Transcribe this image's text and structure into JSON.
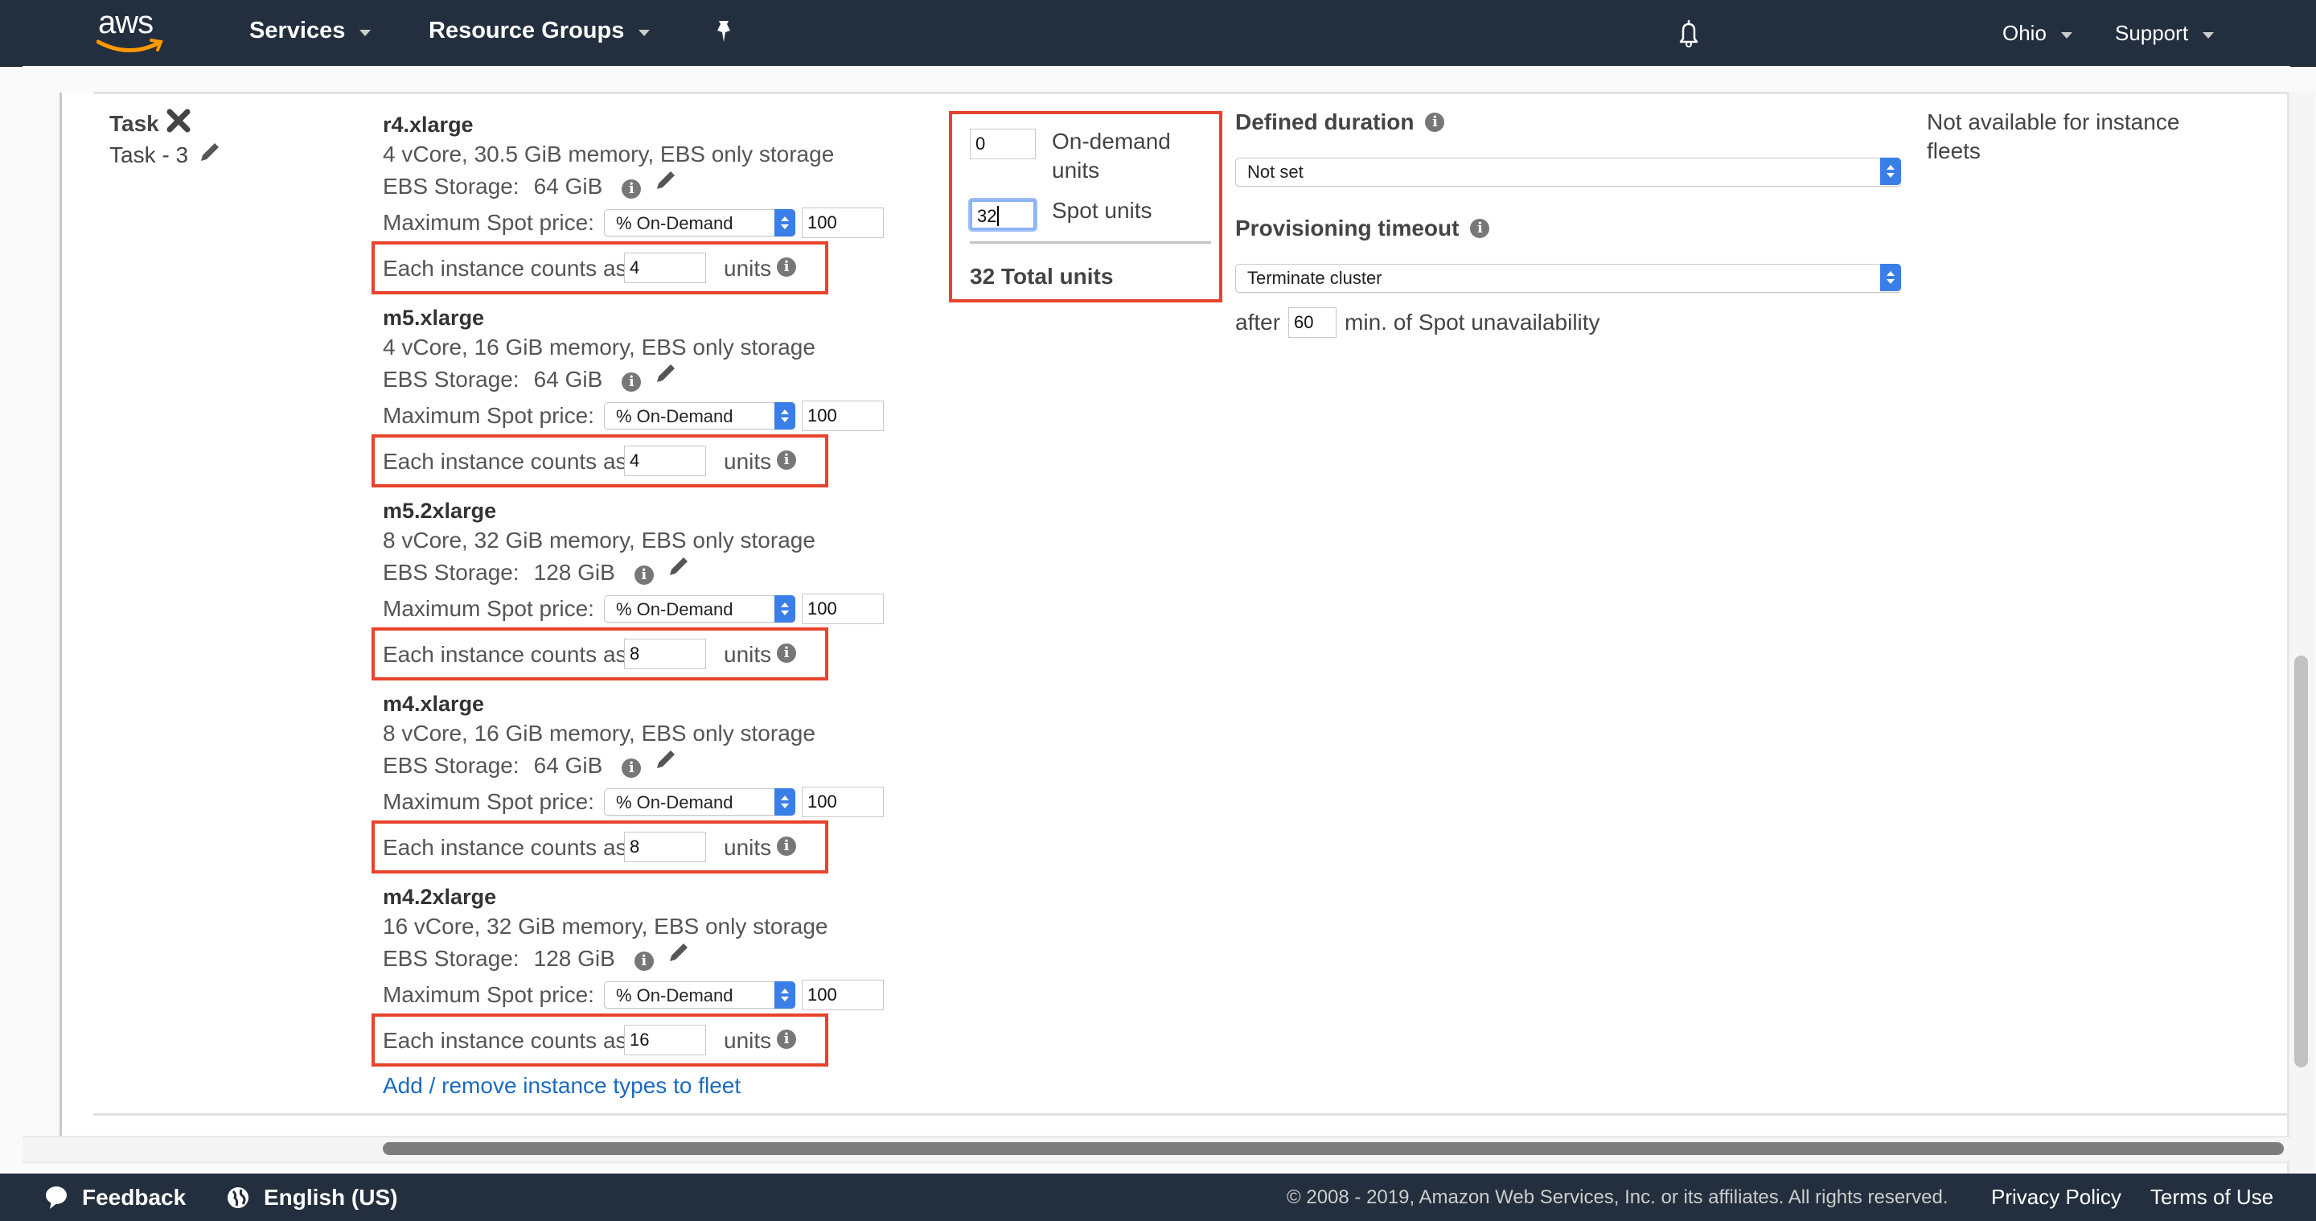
{
  "nav": {
    "logo_text": "aws",
    "services_label": "Services",
    "resource_groups_label": "Resource Groups",
    "region_label": "Ohio",
    "support_label": "Support",
    "icons": {
      "pin": "pin-icon",
      "bell": "bell-icon"
    }
  },
  "task": {
    "title": "Task",
    "name": "Task - 3"
  },
  "instances": [
    {
      "name": "r4.xlarge",
      "specs": "4 vCore, 30.5 GiB memory, EBS only storage",
      "ebs_label": "EBS Storage:",
      "ebs_value": "64 GiB",
      "price_label": "Maximum Spot price:",
      "price_mode": "% On-Demand",
      "price_value": "100",
      "units_label": "Each instance counts as",
      "units_value": "4",
      "units_suffix": "units"
    },
    {
      "name": "m5.xlarge",
      "specs": "4 vCore, 16 GiB memory, EBS only storage",
      "ebs_label": "EBS Storage:",
      "ebs_value": "64 GiB",
      "price_label": "Maximum Spot price:",
      "price_mode": "% On-Demand",
      "price_value": "100",
      "units_label": "Each instance counts as",
      "units_value": "4",
      "units_suffix": "units"
    },
    {
      "name": "m5.2xlarge",
      "specs": "8 vCore, 32 GiB memory, EBS only storage",
      "ebs_label": "EBS Storage:",
      "ebs_value": "128 GiB",
      "price_label": "Maximum Spot price:",
      "price_mode": "% On-Demand",
      "price_value": "100",
      "units_label": "Each instance counts as",
      "units_value": "8",
      "units_suffix": "units"
    },
    {
      "name": "m4.xlarge",
      "specs": "8 vCore, 16 GiB memory, EBS only storage",
      "ebs_label": "EBS Storage:",
      "ebs_value": "64 GiB",
      "price_label": "Maximum Spot price:",
      "price_mode": "% On-Demand",
      "price_value": "100",
      "units_label": "Each instance counts as",
      "units_value": "8",
      "units_suffix": "units"
    },
    {
      "name": "m4.2xlarge",
      "specs": "16 vCore, 32 GiB memory, EBS only storage",
      "ebs_label": "EBS Storage:",
      "ebs_value": "128 GiB",
      "price_label": "Maximum Spot price:",
      "price_mode": "% On-Demand",
      "price_value": "100",
      "units_label": "Each instance counts as",
      "units_value": "16",
      "units_suffix": "units"
    }
  ],
  "add_remove_link": "Add / remove instance types to fleet",
  "capacity": {
    "on_demand_value": "0",
    "on_demand_label": "On-demand units",
    "spot_value": "32",
    "spot_label": "Spot units",
    "total_label": "32 Total units"
  },
  "defined_duration": {
    "label": "Defined duration",
    "selected": "Not set"
  },
  "provisioning_timeout": {
    "label": "Provisioning timeout",
    "selected": "Terminate cluster",
    "after_label": "after",
    "minutes_value": "60",
    "suffix": "min. of Spot unavailability"
  },
  "right_note": "Not available for instance fleets",
  "footer": {
    "feedback_label": "Feedback",
    "language_label": "English (US)",
    "copyright": "© 2008 - 2019, Amazon Web Services, Inc. or its affiliates. All rights reserved.",
    "privacy_label": "Privacy Policy",
    "terms_label": "Terms of Use"
  },
  "colors": {
    "nav_bg": "#232f3e",
    "highlight_border": "#e8432b",
    "select_accent": "#3a7ee8",
    "link": "#1a6bc0"
  }
}
